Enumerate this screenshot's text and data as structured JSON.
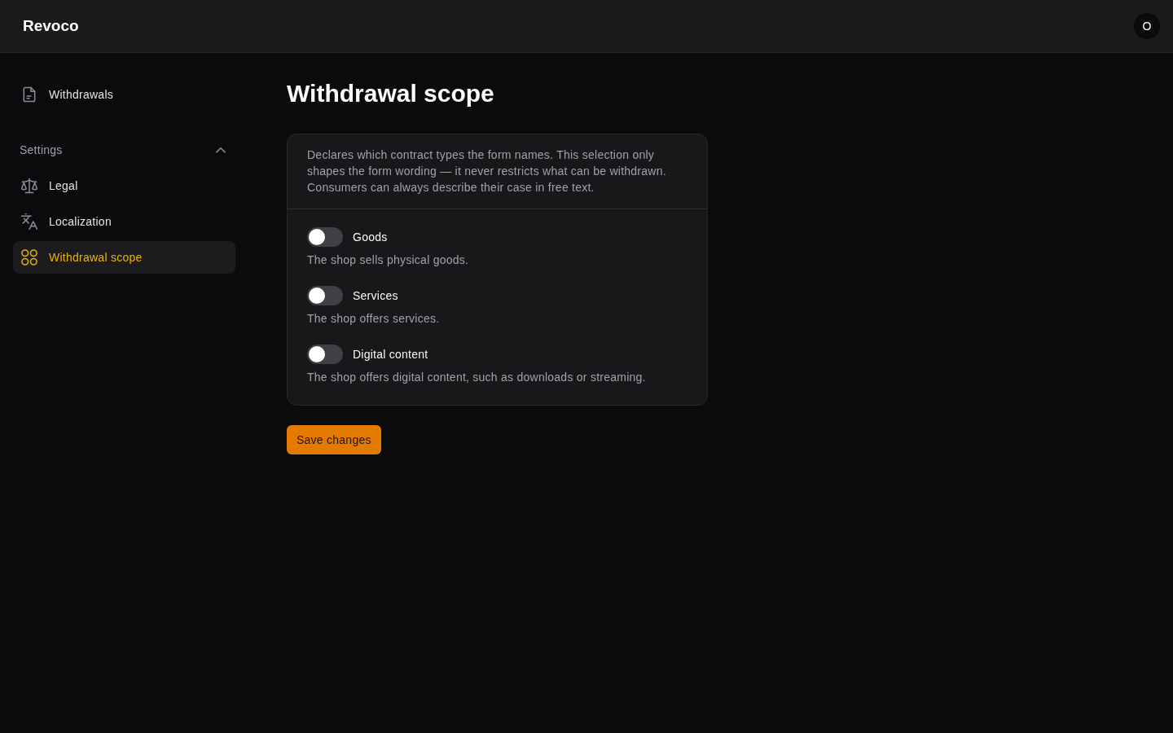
{
  "header": {
    "logo": "Revoco",
    "avatar": "O"
  },
  "sidebar": {
    "items": [
      {
        "label": "Withdrawals",
        "selected": false
      }
    ],
    "groups": [
      {
        "label": "Settings",
        "expanded": true,
        "items": [
          {
            "label": "Legal",
            "selected": false
          },
          {
            "label": "Localization",
            "selected": false
          },
          {
            "label": "Withdrawal scope",
            "selected": true
          }
        ]
      }
    ]
  },
  "main": {
    "title": "Withdrawal scope",
    "card": {
      "description": "Declares which contract types the form names. This selection only shapes the form wording — it never restricts what can be withdrawn. Consumers can always describe their case in free text.",
      "options": [
        {
          "label": "Goods",
          "description": "The shop sells physical goods.",
          "on": false
        },
        {
          "label": "Services",
          "description": "The shop offers services.",
          "on": false
        },
        {
          "label": "Digital content",
          "description": "The shop offers digital content, such as downloads or streaming.",
          "on": false
        }
      ]
    },
    "save_button": {
      "label": "Save changes"
    }
  }
}
